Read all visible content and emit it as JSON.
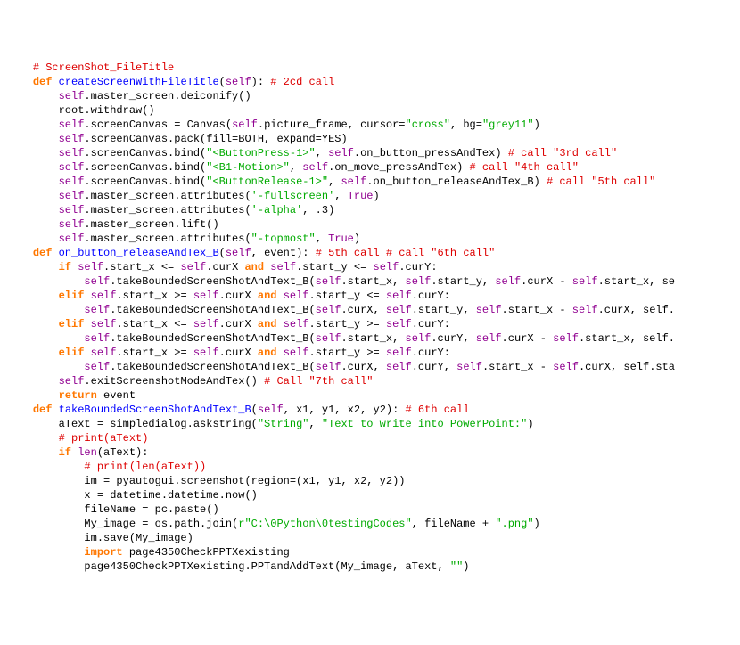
{
  "lines": [
    [
      [
        "    ",
        ""
      ],
      [
        "# ScreenShot_FileTitle",
        "comm"
      ]
    ],
    [
      [
        "    ",
        ""
      ],
      [
        "def ",
        "kw"
      ],
      [
        "createScreenWithFileTitle",
        "fname"
      ],
      [
        "(",
        ""
      ],
      [
        "self",
        "builtin"
      ],
      [
        "): ",
        ""
      ],
      [
        "# 2cd call",
        "comm"
      ]
    ],
    [
      [
        "        ",
        ""
      ],
      [
        "self",
        "builtin"
      ],
      [
        ".master_screen.deiconify()",
        ""
      ]
    ],
    [
      [
        "        root.withdraw()",
        ""
      ]
    ],
    [
      [
        "        ",
        ""
      ],
      [
        "self",
        "builtin"
      ],
      [
        ".screenCanvas = Canvas(",
        ""
      ],
      [
        "self",
        "builtin"
      ],
      [
        ".picture_frame, cursor=",
        ""
      ],
      [
        "\"cross\"",
        "str"
      ],
      [
        ", bg=",
        ""
      ],
      [
        "\"grey11\"",
        "str"
      ],
      [
        ")",
        ""
      ]
    ],
    [
      [
        "        ",
        ""
      ],
      [
        "self",
        "builtin"
      ],
      [
        ".screenCanvas.pack(fill=BOTH, expand=YES)",
        ""
      ]
    ],
    [
      [
        "        ",
        ""
      ],
      [
        "self",
        "builtin"
      ],
      [
        ".screenCanvas.bind(",
        ""
      ],
      [
        "\"<ButtonPress-1>\"",
        "str"
      ],
      [
        ", ",
        ""
      ],
      [
        "self",
        "builtin"
      ],
      [
        ".on_button_pressAndTex) ",
        ""
      ],
      [
        "# call \"3rd call\"",
        "comm"
      ]
    ],
    [
      [
        "        ",
        ""
      ],
      [
        "self",
        "builtin"
      ],
      [
        ".screenCanvas.bind(",
        ""
      ],
      [
        "\"<B1-Motion>\"",
        "str"
      ],
      [
        ", ",
        ""
      ],
      [
        "self",
        "builtin"
      ],
      [
        ".on_move_pressAndTex) ",
        ""
      ],
      [
        "# call \"4th call\"",
        "comm"
      ]
    ],
    [
      [
        "        ",
        ""
      ],
      [
        "self",
        "builtin"
      ],
      [
        ".screenCanvas.bind(",
        ""
      ],
      [
        "\"<ButtonRelease-1>\"",
        "str"
      ],
      [
        ", ",
        ""
      ],
      [
        "self",
        "builtin"
      ],
      [
        ".on_button_releaseAndTex_B) ",
        ""
      ],
      [
        "# call \"5th call\"",
        "comm"
      ]
    ],
    [
      [
        "        ",
        ""
      ],
      [
        "self",
        "builtin"
      ],
      [
        ".master_screen.attributes(",
        ""
      ],
      [
        "'-fullscreen'",
        "str"
      ],
      [
        ", ",
        ""
      ],
      [
        "True",
        "builtin"
      ],
      [
        ")",
        ""
      ]
    ],
    [
      [
        "        ",
        ""
      ],
      [
        "self",
        "builtin"
      ],
      [
        ".master_screen.attributes(",
        ""
      ],
      [
        "'-alpha'",
        "str"
      ],
      [
        ", .3)",
        ""
      ]
    ],
    [
      [
        "        ",
        ""
      ],
      [
        "self",
        "builtin"
      ],
      [
        ".master_screen.lift()",
        ""
      ]
    ],
    [
      [
        "        ",
        ""
      ],
      [
        "self",
        "builtin"
      ],
      [
        ".master_screen.attributes(",
        ""
      ],
      [
        "\"-topmost\"",
        "str"
      ],
      [
        ", ",
        ""
      ],
      [
        "True",
        "builtin"
      ],
      [
        ")",
        ""
      ]
    ],
    [
      [
        "    ",
        ""
      ],
      [
        "def ",
        "kw"
      ],
      [
        "on_button_releaseAndTex_B",
        "fname"
      ],
      [
        "(",
        ""
      ],
      [
        "self",
        "builtin"
      ],
      [
        ", event): ",
        ""
      ],
      [
        "# 5th call # call \"6th call\"",
        "comm"
      ]
    ],
    [
      [
        "        ",
        ""
      ],
      [
        "if ",
        "kw"
      ],
      [
        "self",
        "builtin"
      ],
      [
        ".start_x <= ",
        ""
      ],
      [
        "self",
        "builtin"
      ],
      [
        ".curX ",
        ""
      ],
      [
        "and ",
        "kw"
      ],
      [
        "self",
        "builtin"
      ],
      [
        ".start_y <= ",
        ""
      ],
      [
        "self",
        "builtin"
      ],
      [
        ".curY:",
        ""
      ]
    ],
    [
      [
        "            ",
        ""
      ],
      [
        "self",
        "builtin"
      ],
      [
        ".takeBoundedScreenShotAndText_B(",
        ""
      ],
      [
        "self",
        "builtin"
      ],
      [
        ".start_x, ",
        ""
      ],
      [
        "self",
        "builtin"
      ],
      [
        ".start_y, ",
        ""
      ],
      [
        "self",
        "builtin"
      ],
      [
        ".curX - ",
        ""
      ],
      [
        "self",
        "builtin"
      ],
      [
        ".start_x, se",
        ""
      ]
    ],
    [
      [
        "        ",
        ""
      ],
      [
        "elif ",
        "kw"
      ],
      [
        "self",
        "builtin"
      ],
      [
        ".start_x >= ",
        ""
      ],
      [
        "self",
        "builtin"
      ],
      [
        ".curX ",
        ""
      ],
      [
        "and ",
        "kw"
      ],
      [
        "self",
        "builtin"
      ],
      [
        ".start_y <= ",
        ""
      ],
      [
        "self",
        "builtin"
      ],
      [
        ".curY:",
        ""
      ]
    ],
    [
      [
        "            ",
        ""
      ],
      [
        "self",
        "builtin"
      ],
      [
        ".takeBoundedScreenShotAndText_B(",
        ""
      ],
      [
        "self",
        "builtin"
      ],
      [
        ".curX, ",
        ""
      ],
      [
        "self",
        "builtin"
      ],
      [
        ".start_y, ",
        ""
      ],
      [
        "self",
        "builtin"
      ],
      [
        ".start_x - ",
        ""
      ],
      [
        "self",
        "builtin"
      ],
      [
        ".curX, self.",
        ""
      ]
    ],
    [
      [
        "        ",
        ""
      ],
      [
        "elif ",
        "kw"
      ],
      [
        "self",
        "builtin"
      ],
      [
        ".start_x <= ",
        ""
      ],
      [
        "self",
        "builtin"
      ],
      [
        ".curX ",
        ""
      ],
      [
        "and ",
        "kw"
      ],
      [
        "self",
        "builtin"
      ],
      [
        ".start_y >= ",
        ""
      ],
      [
        "self",
        "builtin"
      ],
      [
        ".curY:",
        ""
      ]
    ],
    [
      [
        "            ",
        ""
      ],
      [
        "self",
        "builtin"
      ],
      [
        ".takeBoundedScreenShotAndText_B(",
        ""
      ],
      [
        "self",
        "builtin"
      ],
      [
        ".start_x, ",
        ""
      ],
      [
        "self",
        "builtin"
      ],
      [
        ".curY, ",
        ""
      ],
      [
        "self",
        "builtin"
      ],
      [
        ".curX - ",
        ""
      ],
      [
        "self",
        "builtin"
      ],
      [
        ".start_x, self.",
        ""
      ]
    ],
    [
      [
        "        ",
        ""
      ],
      [
        "elif ",
        "kw"
      ],
      [
        "self",
        "builtin"
      ],
      [
        ".start_x >= ",
        ""
      ],
      [
        "self",
        "builtin"
      ],
      [
        ".curX ",
        ""
      ],
      [
        "and ",
        "kw"
      ],
      [
        "self",
        "builtin"
      ],
      [
        ".start_y >= ",
        ""
      ],
      [
        "self",
        "builtin"
      ],
      [
        ".curY:",
        ""
      ]
    ],
    [
      [
        "            ",
        ""
      ],
      [
        "self",
        "builtin"
      ],
      [
        ".takeBoundedScreenShotAndText_B(",
        ""
      ],
      [
        "self",
        "builtin"
      ],
      [
        ".curX, ",
        ""
      ],
      [
        "self",
        "builtin"
      ],
      [
        ".curY, ",
        ""
      ],
      [
        "self",
        "builtin"
      ],
      [
        ".start_x - ",
        ""
      ],
      [
        "self",
        "builtin"
      ],
      [
        ".curX, self.sta",
        ""
      ]
    ],
    [
      [
        "        ",
        ""
      ],
      [
        "self",
        "builtin"
      ],
      [
        ".exitScreenshotModeAndTex() ",
        ""
      ],
      [
        "# Call \"7th call\"",
        "comm"
      ]
    ],
    [
      [
        "        ",
        ""
      ],
      [
        "return ",
        "kw"
      ],
      [
        "event",
        ""
      ]
    ],
    [
      [
        "    ",
        ""
      ],
      [
        "def ",
        "kw"
      ],
      [
        "takeBoundedScreenShotAndText_B",
        "fname"
      ],
      [
        "(",
        ""
      ],
      [
        "self",
        "builtin"
      ],
      [
        ", x1, y1, x2, y2): ",
        ""
      ],
      [
        "# 6th call",
        "comm"
      ]
    ],
    [
      [
        "        aText = simpledialog.askstring(",
        ""
      ],
      [
        "\"String\"",
        "str"
      ],
      [
        ", ",
        ""
      ],
      [
        "\"Text to write into PowerPoint:\"",
        "str"
      ],
      [
        ")",
        ""
      ]
    ],
    [
      [
        "        ",
        ""
      ],
      [
        "# print(aText)",
        "comm"
      ]
    ],
    [
      [
        "        ",
        ""
      ],
      [
        "if ",
        "kw"
      ],
      [
        "len",
        "builtin"
      ],
      [
        "(aText):",
        ""
      ]
    ],
    [
      [
        "            ",
        ""
      ],
      [
        "# print(len(aText))",
        "comm"
      ]
    ],
    [
      [
        "            im = pyautogui.screenshot(region=(x1, y1, x2, y2))",
        ""
      ]
    ],
    [
      [
        "            x = datetime.datetime.now()",
        ""
      ]
    ],
    [
      [
        "            fileName = pc.paste()",
        ""
      ]
    ],
    [
      [
        "            My_image = os.path.join(",
        ""
      ],
      [
        "r\"C:\\0Python\\0testingCodes\"",
        "str"
      ],
      [
        ", fileName + ",
        ""
      ],
      [
        "\".png\"",
        "str"
      ],
      [
        ")",
        ""
      ]
    ],
    [
      [
        "            im.save(My_image)",
        ""
      ]
    ],
    [
      [
        "            ",
        ""
      ],
      [
        "import ",
        "kw"
      ],
      [
        "page4350CheckPPTXexisting",
        ""
      ]
    ],
    [
      [
        "            page4350CheckPPTXexisting.PPTandAddText(My_image, aText, ",
        ""
      ],
      [
        "\"\"",
        "str"
      ],
      [
        ")",
        ""
      ]
    ]
  ]
}
